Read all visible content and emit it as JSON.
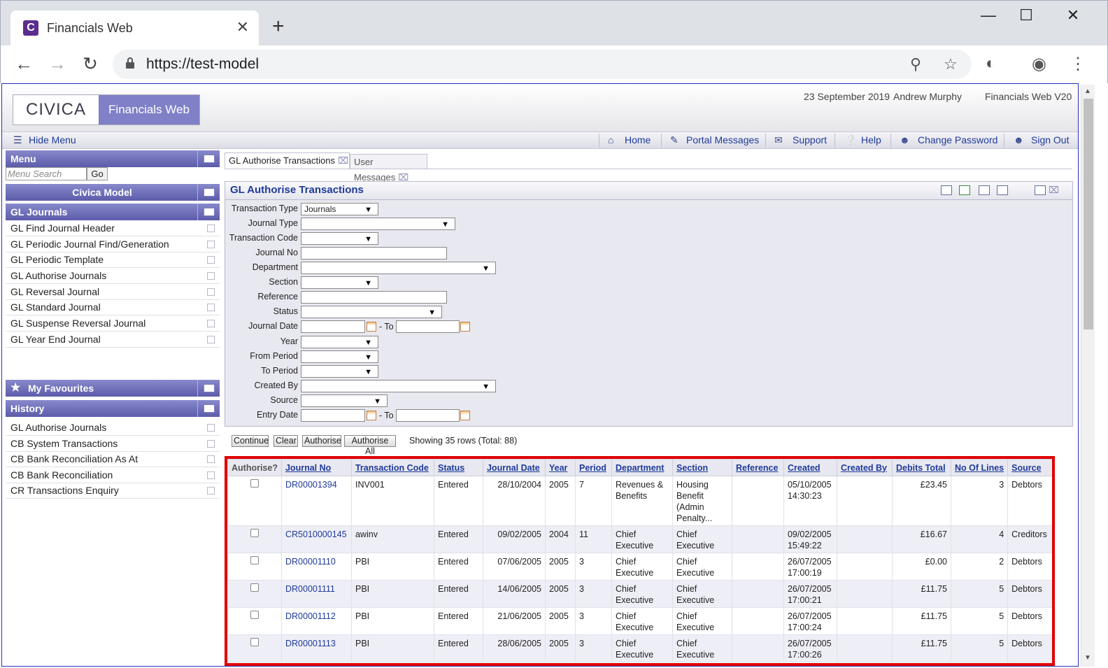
{
  "browser": {
    "tab_title": "Financials Web",
    "tab_close": "✕",
    "new_tab": "+",
    "url": "https://test-model",
    "favicon_letter": "C"
  },
  "app": {
    "logo_text": "CIVICA",
    "product_name": "Financials Web",
    "date": "23 September 2019",
    "user": "Andrew Murphy",
    "version": "Financials Web V20",
    "hide_menu": "Hide Menu",
    "nav": {
      "home": "Home",
      "portal_messages": "Portal Messages",
      "support": "Support",
      "help": "Help",
      "change_password": "Change Password",
      "sign_out": "Sign Out"
    }
  },
  "sidebar": {
    "menu_title": "Menu",
    "search_placeholder": "Menu Search",
    "go_label": "Go",
    "model_title": "Civica Model",
    "section_title": "GL Journals",
    "items": [
      "GL Find Journal Header",
      "GL Periodic Journal Find/Generation",
      "GL Periodic Template",
      "GL Authorise Journals",
      "GL Reversal Journal",
      "GL Standard Journal",
      "GL Suspense Reversal Journal",
      "GL Year End Journal"
    ],
    "favourites_title": "My Favourites",
    "history_title": "History",
    "history": [
      "GL Authorise Journals",
      "CB System Transactions",
      "CB Bank Reconciliation As At",
      "CB Bank Reconciliation",
      "CR Transactions Enquiry"
    ]
  },
  "tabs": {
    "active": "GL Authorise Transactions",
    "inactive": "User Messages"
  },
  "form": {
    "title": "GL Authorise Transactions",
    "labels": {
      "transaction_type": "Transaction Type",
      "journal_type": "Journal Type",
      "transaction_code": "Transaction Code",
      "journal_no": "Journal No",
      "department": "Department",
      "section": "Section",
      "reference": "Reference",
      "status": "Status",
      "journal_date": "Journal Date",
      "year": "Year",
      "from_period": "From Period",
      "to_period": "To Period",
      "created_by": "Created By",
      "source": "Source",
      "entry_date": "Entry Date",
      "to": "- To"
    },
    "values": {
      "transaction_type": "Journals"
    },
    "buttons": {
      "continue": "Continue",
      "clear": "Clear",
      "authorise": "Authorise",
      "authorise_all": "Authorise All"
    },
    "showing": "Showing 35 rows (Total: 88)"
  },
  "grid": {
    "columns": [
      "Authorise?",
      "Journal No",
      "Transaction Code",
      "Status",
      "Journal Date",
      "Year",
      "Period",
      "Department",
      "Section",
      "Reference",
      "Created",
      "Created By",
      "Debits Total",
      "No Of Lines",
      "Source"
    ],
    "rows": [
      {
        "journal_no": "DR00001394",
        "code": "INV001",
        "status": "Entered",
        "date": "28/10/2004",
        "year": "2005",
        "period": "7",
        "dept": "Revenues & Benefits",
        "section": "Housing Benefit (Admin Penalty...",
        "reference": "",
        "created": "05/10/2005 14:30:23",
        "created_by": "",
        "debits": "£23.45",
        "lines": "3",
        "source": "Debtors"
      },
      {
        "journal_no": "CR5010000145",
        "code": "awinv",
        "status": "Entered",
        "date": "09/02/2005",
        "year": "2004",
        "period": "11",
        "dept": "Chief Executive",
        "section": "Chief Executive",
        "reference": "",
        "created": "09/02/2005 15:49:22",
        "created_by": "",
        "debits": "£16.67",
        "lines": "4",
        "source": "Creditors"
      },
      {
        "journal_no": "DR00001110",
        "code": "PBI",
        "status": "Entered",
        "date": "07/06/2005",
        "year": "2005",
        "period": "3",
        "dept": "Chief Executive",
        "section": "Chief Executive",
        "reference": "",
        "created": "26/07/2005 17:00:19",
        "created_by": "",
        "debits": "£0.00",
        "lines": "2",
        "source": "Debtors"
      },
      {
        "journal_no": "DR00001111",
        "code": "PBI",
        "status": "Entered",
        "date": "14/06/2005",
        "year": "2005",
        "period": "3",
        "dept": "Chief Executive",
        "section": "Chief Executive",
        "reference": "",
        "created": "26/07/2005 17:00:21",
        "created_by": "",
        "debits": "£11.75",
        "lines": "5",
        "source": "Debtors"
      },
      {
        "journal_no": "DR00001112",
        "code": "PBI",
        "status": "Entered",
        "date": "21/06/2005",
        "year": "2005",
        "period": "3",
        "dept": "Chief Executive",
        "section": "Chief Executive",
        "reference": "",
        "created": "26/07/2005 17:00:24",
        "created_by": "",
        "debits": "£11.75",
        "lines": "5",
        "source": "Debtors"
      },
      {
        "journal_no": "DR00001113",
        "code": "PBI",
        "status": "Entered",
        "date": "28/06/2005",
        "year": "2005",
        "period": "3",
        "dept": "Chief Executive",
        "section": "Chief Executive",
        "reference": "",
        "created": "26/07/2005 17:00:26",
        "created_by": "",
        "debits": "£11.75",
        "lines": "5",
        "source": "Debtors"
      }
    ]
  }
}
